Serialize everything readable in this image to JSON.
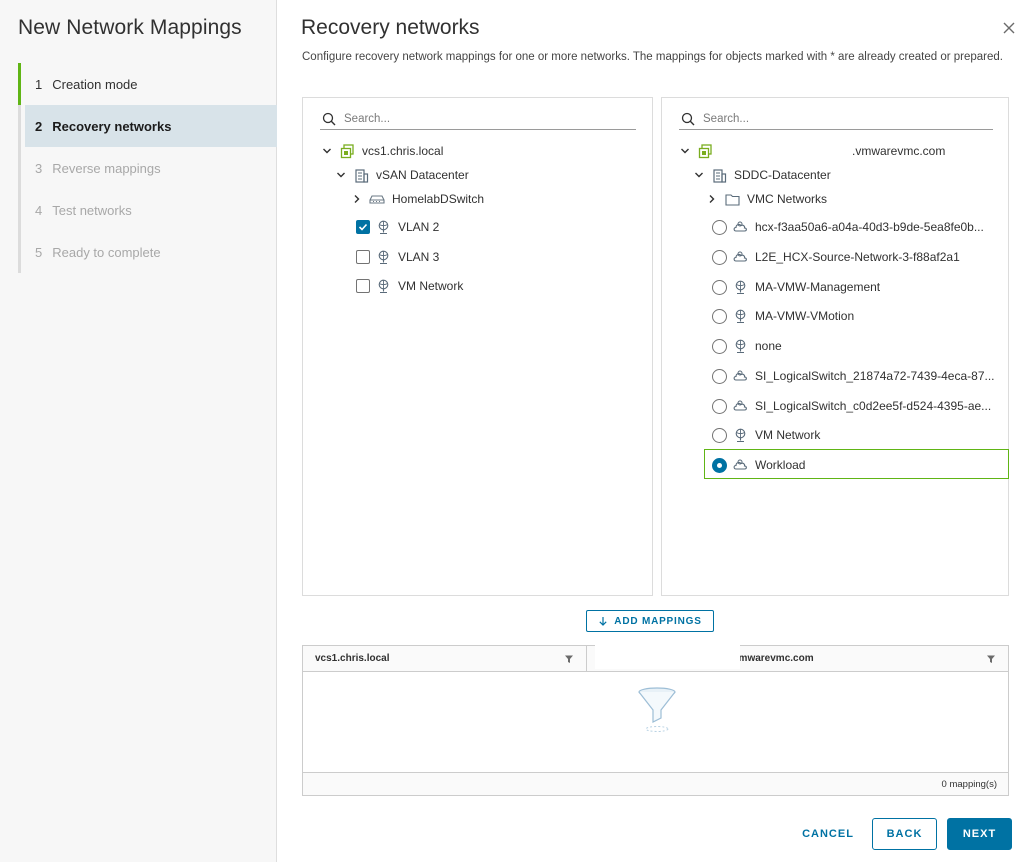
{
  "wizard": {
    "title": "New Network Mappings",
    "steps": [
      {
        "num": "1",
        "label": "Creation mode"
      },
      {
        "num": "2",
        "label": "Recovery networks"
      },
      {
        "num": "3",
        "label": "Reverse mappings"
      },
      {
        "num": "4",
        "label": "Test networks"
      },
      {
        "num": "5",
        "label": "Ready to complete"
      }
    ]
  },
  "main": {
    "title": "Recovery networks",
    "description": "Configure recovery network mappings for one or more networks. The mappings for objects marked with * are already created or prepared."
  },
  "left_panel": {
    "search_placeholder": "Search...",
    "vcenter": "vcs1.chris.local",
    "datacenter": "vSAN Datacenter",
    "switch": "HomelabDSwitch",
    "networks": [
      {
        "label": "VLAN 2",
        "checked": true
      },
      {
        "label": "VLAN 3",
        "checked": false
      },
      {
        "label": "VM Network",
        "checked": false
      }
    ]
  },
  "right_panel": {
    "search_placeholder": "Search...",
    "vcenter": ".vmwarevmc.com",
    "datacenter": "SDDC-Datacenter",
    "folder": "VMC Networks",
    "networks": [
      {
        "label": "hcx-f3aa50a6-a04a-40d3-b9de-5ea8fe0b...",
        "selected": false
      },
      {
        "label": "L2E_HCX-Source-Network-3-f88af2a1",
        "selected": false
      },
      {
        "label": "MA-VMW-Management",
        "selected": false
      },
      {
        "label": "MA-VMW-VMotion",
        "selected": false
      },
      {
        "label": "none",
        "selected": false
      },
      {
        "label": "SI_LogicalSwitch_21874a72-7439-4eca-87...",
        "selected": false
      },
      {
        "label": "SI_LogicalSwitch_c0d2ee5f-d524-4395-ae...",
        "selected": false
      },
      {
        "label": "VM Network",
        "selected": false
      },
      {
        "label": "Workload",
        "selected": true
      }
    ]
  },
  "add_mappings_label": "ADD MAPPINGS",
  "grid": {
    "col1": "vcs1.chris.local",
    "col2": "vmwarevmc.com",
    "footer": "0 mapping(s)"
  },
  "buttons": {
    "cancel": "CANCEL",
    "back": "BACK",
    "next": "NEXT"
  },
  "colors": {
    "accent": "#0072a3",
    "done": "#60b515",
    "active_bg": "#d8e3e9"
  }
}
